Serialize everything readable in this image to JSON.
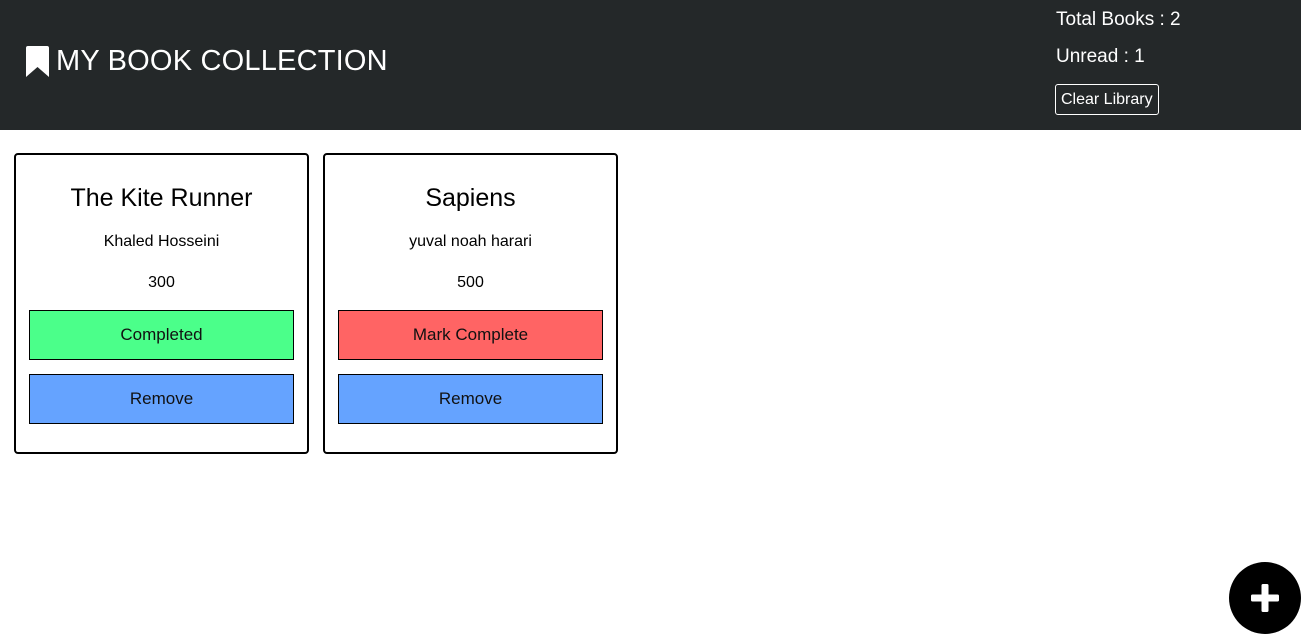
{
  "header": {
    "title": "MY BOOK COLLECTION",
    "icon": "bookmark-icon",
    "total_books": "Total Books : 2",
    "unread": "Unread : 1",
    "clear_label": "Clear Library"
  },
  "books": [
    {
      "title": "The Kite Runner",
      "author": "Khaled Hosseini",
      "pages": "300",
      "status_label": "Completed",
      "completed": true,
      "remove_label": "Remove"
    },
    {
      "title": "Sapiens",
      "author": "yuval noah harari",
      "pages": "500",
      "status_label": "Mark Complete",
      "completed": false,
      "remove_label": "Remove"
    }
  ],
  "add_button": {
    "icon": "plus-icon"
  },
  "colors": {
    "header_bg": "#242829",
    "completed": "#4bff8a",
    "incomplete": "#ff6464",
    "remove": "#65a3ff",
    "fab": "#000000"
  }
}
